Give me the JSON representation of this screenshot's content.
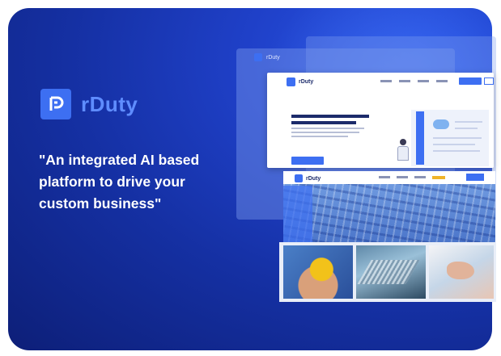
{
  "brand": {
    "name": "rDuty",
    "accent": "#3d6ff2",
    "background": "#1530a3",
    "logo_icon": "rduty-logo-icon"
  },
  "tagline": {
    "lines": [
      "\"An integrated AI based",
      "platform to drive your",
      "custom business\""
    ]
  },
  "mockups": {
    "back_window_title": "rDuty",
    "front_window_title": "rDuty",
    "lower_window_title": "rDuty"
  }
}
